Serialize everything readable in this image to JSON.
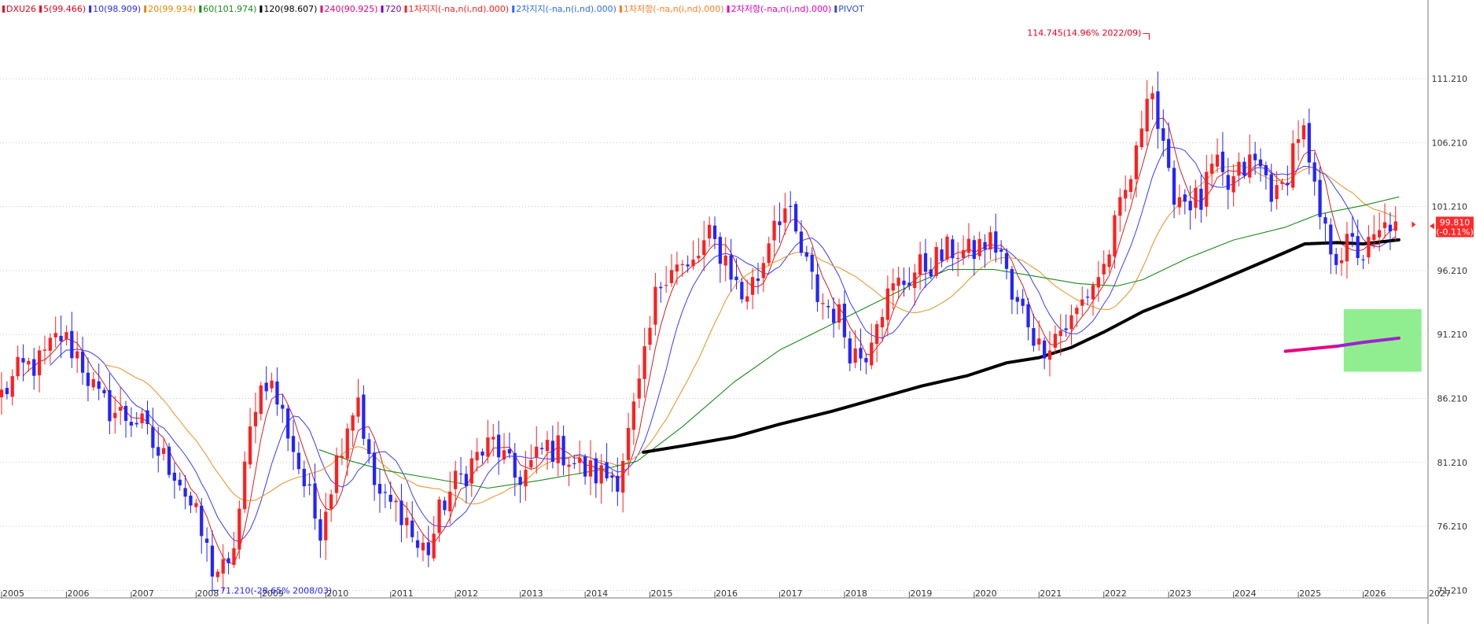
{
  "legend": [
    {
      "text": "DXU26",
      "color": "#e8001c"
    },
    {
      "text": "5(99.466)",
      "color": "#e8001c"
    },
    {
      "text": "10(98.909)",
      "color": "#2b2bff"
    },
    {
      "text": "20(99.934)",
      "color": "#e08800"
    },
    {
      "text": "60(101.974)",
      "color": "#1a8a1a"
    },
    {
      "text": "120(98.607)",
      "color": "#000000"
    },
    {
      "text": "240(90.925)",
      "color": "#e6007e"
    },
    {
      "text": "720",
      "color": "#7a00b8"
    },
    {
      "text": "1차지지(-na,n(i,nd).000)",
      "color": "#ff2020"
    },
    {
      "text": "2차지지(-na,n(i,nd).000)",
      "color": "#2b6bff"
    },
    {
      "text": "1차저항(-na,n(i,nd).000)",
      "color": "#ff7a20"
    },
    {
      "text": "2차저항(-na,n(i,nd).000)",
      "color": "#e000c0"
    },
    {
      "text": "PIVOT",
      "color": "#3050c0"
    }
  ],
  "annotations": {
    "high": "114.745(14.96% 2022/09)",
    "low": "71.210(-28.65% 2008/03)",
    "current_price": "99.810",
    "current_change": "(-0.11%)"
  },
  "colors": {
    "up": "#ff1f1f",
    "down": "#2424ff",
    "ma5": "#d42020",
    "ma10": "#3a3aff",
    "ma20": "#e89a30",
    "ma60": "#1a8a1a",
    "ma120": "#000000",
    "ma240": "#e6007e",
    "box": "#90ee90",
    "grid": "#c8c8c8"
  },
  "chart_data": {
    "type": "candlestick",
    "symbol": "DXU26",
    "interval": "monthly",
    "y_ticks": [
      "111.210",
      "106.210",
      "101.210",
      "96.210",
      "91.210",
      "86.210",
      "81.210",
      "76.210",
      "71.210"
    ],
    "y_tick_values": [
      111.21,
      106.21,
      101.21,
      96.21,
      91.21,
      86.21,
      81.21,
      76.21,
      71.21
    ],
    "ylim": [
      70.8,
      117.0
    ],
    "x_ticks": [
      "2005",
      "2006",
      "2007",
      "2008",
      "2009",
      "2010",
      "2011",
      "2012",
      "2013",
      "2014",
      "2015",
      "2016",
      "2017",
      "2018",
      "2019",
      "2020",
      "2021",
      "2022",
      "2023",
      "2024",
      "2025",
      "2026",
      "2027"
    ],
    "x_range_years": [
      2005.0,
      2027.0
    ],
    "high_point": {
      "value": 114.745,
      "date": "2022/09"
    },
    "low_point": {
      "value": 71.21,
      "date": "2008/03"
    },
    "last": {
      "value": 99.81
    },
    "ma_shown": {
      "ma60_from": 2009.9,
      "ma120_from": 2014.9,
      "ma240_from": 2024.8
    },
    "highlight_box": {
      "x0": 2025.7,
      "x1": 2026.9,
      "y0": 88.3,
      "y1": 93.2
    },
    "anchors": [
      [
        2005.0,
        86.5
      ],
      [
        2005.3,
        88.5
      ],
      [
        2005.6,
        89.0
      ],
      [
        2005.9,
        91.2
      ],
      [
        2006.2,
        89.5
      ],
      [
        2006.5,
        86.0
      ],
      [
        2006.8,
        85.0
      ],
      [
        2007.1,
        84.5
      ],
      [
        2007.4,
        82.0
      ],
      [
        2007.7,
        80.5
      ],
      [
        2008.0,
        76.8
      ],
      [
        2008.25,
        73.0
      ],
      [
        2008.5,
        72.5
      ],
      [
        2008.7,
        78.5
      ],
      [
        2008.9,
        86.0
      ],
      [
        2009.1,
        88.0
      ],
      [
        2009.4,
        84.0
      ],
      [
        2009.7,
        79.0
      ],
      [
        2009.9,
        76.0
      ],
      [
        2010.1,
        80.0
      ],
      [
        2010.3,
        84.0
      ],
      [
        2010.5,
        86.5
      ],
      [
        2010.7,
        80.0
      ],
      [
        2010.9,
        78.0
      ],
      [
        2011.2,
        77.5
      ],
      [
        2011.4,
        74.5
      ],
      [
        2011.6,
        74.5
      ],
      [
        2011.8,
        78.0
      ],
      [
        2012.0,
        79.5
      ],
      [
        2012.3,
        81.5
      ],
      [
        2012.6,
        82.8
      ],
      [
        2012.9,
        80.0
      ],
      [
        2013.1,
        80.5
      ],
      [
        2013.4,
        82.5
      ],
      [
        2013.7,
        82.0
      ],
      [
        2013.9,
        80.8
      ],
      [
        2014.2,
        80.2
      ],
      [
        2014.5,
        80.2
      ],
      [
        2014.7,
        84.0
      ],
      [
        2014.9,
        88.5
      ],
      [
        2015.1,
        94.5
      ],
      [
        2015.3,
        97.0
      ],
      [
        2015.6,
        96.0
      ],
      [
        2015.9,
        98.8
      ],
      [
        2016.2,
        97.0
      ],
      [
        2016.4,
        94.0
      ],
      [
        2016.7,
        96.0
      ],
      [
        2016.9,
        100.5
      ],
      [
        2017.1,
        101.0
      ],
      [
        2017.3,
        98.0
      ],
      [
        2017.6,
        94.0
      ],
      [
        2017.9,
        92.8
      ],
      [
        2018.1,
        90.0
      ],
      [
        2018.3,
        89.5
      ],
      [
        2018.5,
        93.0
      ],
      [
        2018.8,
        95.0
      ],
      [
        2019.1,
        96.2
      ],
      [
        2019.4,
        97.0
      ],
      [
        2019.7,
        98.0
      ],
      [
        2019.9,
        97.4
      ],
      [
        2020.2,
        98.5
      ],
      [
        2020.4,
        98.0
      ],
      [
        2020.6,
        93.5
      ],
      [
        2020.8,
        92.8
      ],
      [
        2021.0,
        90.2
      ],
      [
        2021.3,
        91.5
      ],
      [
        2021.5,
        92.2
      ],
      [
        2021.8,
        95.0
      ],
      [
        2022.0,
        96.5
      ],
      [
        2022.2,
        100.0
      ],
      [
        2022.5,
        105.0
      ],
      [
        2022.7,
        112.0
      ],
      [
        2022.85,
        107.0
      ],
      [
        2023.0,
        103.0
      ],
      [
        2023.2,
        102.0
      ],
      [
        2023.5,
        101.5
      ],
      [
        2023.7,
        104.5
      ],
      [
        2023.9,
        102.5
      ],
      [
        2024.1,
        103.8
      ],
      [
        2024.3,
        104.8
      ],
      [
        2024.5,
        103.5
      ],
      [
        2024.7,
        101.5
      ],
      [
        2024.9,
        105.5
      ],
      [
        2025.05,
        107.8
      ],
      [
        2025.2,
        103.0
      ],
      [
        2025.4,
        99.0
      ],
      [
        2025.6,
        97.5
      ],
      [
        2025.8,
        98.2
      ],
      [
        2026.0,
        97.5
      ],
      [
        2026.2,
        98.5
      ],
      [
        2026.45,
        100.3
      ],
      [
        2026.55,
        99.81
      ]
    ],
    "ma_anchors": {
      "ma60": [
        [
          2009.9,
          82.2
        ],
        [
          2010.4,
          81.3
        ],
        [
          2010.9,
          80.6
        ],
        [
          2011.6,
          80.0
        ],
        [
          2012.5,
          79.2
        ],
        [
          2013.3,
          79.8
        ],
        [
          2014.3,
          80.7
        ],
        [
          2014.8,
          81.3
        ],
        [
          2015.5,
          84.0
        ],
        [
          2016.3,
          87.5
        ],
        [
          2017.0,
          90.0
        ],
        [
          2018.0,
          92.5
        ],
        [
          2019.0,
          95.0
        ],
        [
          2019.6,
          96.3
        ],
        [
          2020.3,
          96.3
        ],
        [
          2020.9,
          95.8
        ],
        [
          2021.6,
          95.2
        ],
        [
          2022.2,
          95.0
        ],
        [
          2022.6,
          95.5
        ],
        [
          2023.3,
          97.2
        ],
        [
          2024.0,
          98.6
        ],
        [
          2024.8,
          99.6
        ],
        [
          2025.3,
          100.6
        ],
        [
          2026.0,
          101.3
        ],
        [
          2026.55,
          101.97
        ]
      ],
      "ma120": [
        [
          2014.9,
          82.0
        ],
        [
          2015.5,
          82.5
        ],
        [
          2016.3,
          83.2
        ],
        [
          2017.0,
          84.2
        ],
        [
          2017.8,
          85.2
        ],
        [
          2018.5,
          86.2
        ],
        [
          2019.2,
          87.2
        ],
        [
          2019.9,
          88.0
        ],
        [
          2020.5,
          89.0
        ],
        [
          2021.0,
          89.4
        ],
        [
          2021.5,
          90.2
        ],
        [
          2022.0,
          91.4
        ],
        [
          2022.6,
          93.0
        ],
        [
          2023.3,
          94.4
        ],
        [
          2024.0,
          95.9
        ],
        [
          2024.6,
          97.2
        ],
        [
          2025.1,
          98.3
        ],
        [
          2025.6,
          98.4
        ],
        [
          2026.0,
          98.3
        ],
        [
          2026.55,
          98.61
        ]
      ],
      "ma240": [
        [
          2024.8,
          89.9
        ],
        [
          2025.2,
          90.1
        ],
        [
          2025.6,
          90.3
        ],
        [
          2026.0,
          90.6
        ],
        [
          2026.55,
          90.93
        ]
      ]
    }
  }
}
